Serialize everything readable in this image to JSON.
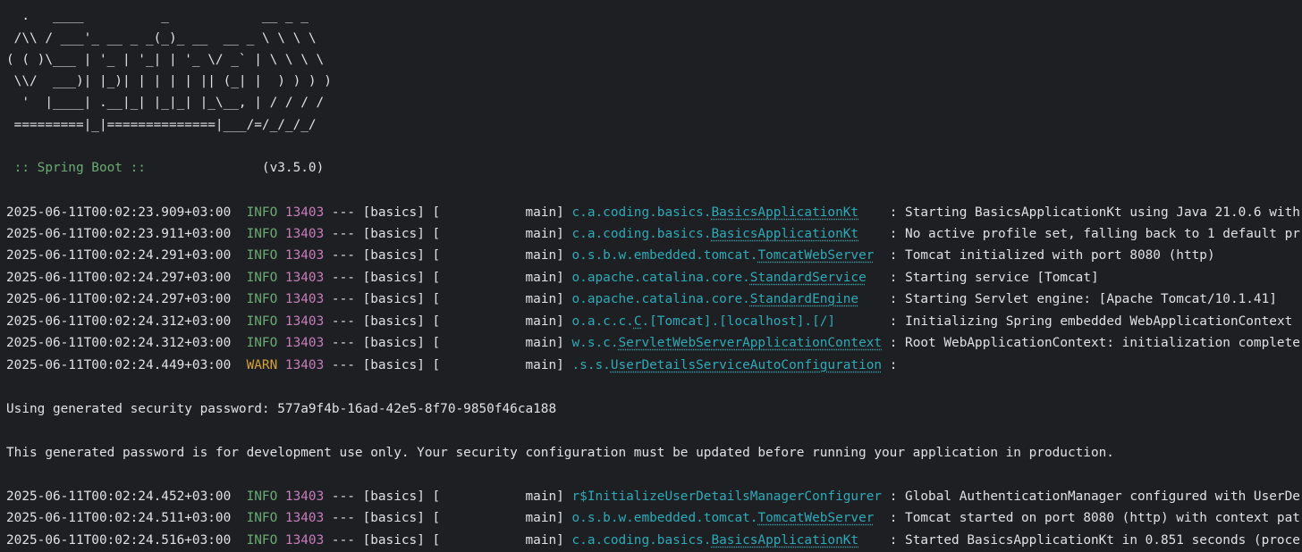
{
  "banner": [
    "  .   ____          _            __ _ _",
    " /\\\\ / ___'_ __ _ _(_)_ __  __ _ \\ \\ \\ \\",
    "( ( )\\___ | '_ | '_| | '_ \\/ _` | \\ \\ \\ \\",
    " \\\\/  ___)| |_)| | | | | || (_| |  ) ) ) )",
    "  '  |____| .__|_| |_|_| |_\\__, | / / / /",
    " =========|_|==============|___/=/_/_/_/"
  ],
  "spring_boot_label": " :: Spring Boot ::",
  "spring_boot_version": "(v3.5.0)",
  "logs_part1": [
    {
      "timestamp": "2025-06-11T00:02:23.909+03:00",
      "level": " INFO",
      "pid": "13403",
      "sep": " --- [basics] [           main] ",
      "logger_prefix": "c.a.coding.basics.",
      "logger_class": "BasicsApplicationKt",
      "logger_pad": "    ",
      "message": ": Starting BasicsApplicationKt using Java 21.0.6 with"
    },
    {
      "timestamp": "2025-06-11T00:02:23.911+03:00",
      "level": " INFO",
      "pid": "13403",
      "sep": " --- [basics] [           main] ",
      "logger_prefix": "c.a.coding.basics.",
      "logger_class": "BasicsApplicationKt",
      "logger_pad": "    ",
      "message": ": No active profile set, falling back to 1 default pr"
    },
    {
      "timestamp": "2025-06-11T00:02:24.291+03:00",
      "level": " INFO",
      "pid": "13403",
      "sep": " --- [basics] [           main] ",
      "logger_prefix": "o.s.b.w.embedded.tomcat.",
      "logger_class": "TomcatWebServer",
      "logger_pad": "  ",
      "message": ": Tomcat initialized with port 8080 (http)"
    },
    {
      "timestamp": "2025-06-11T00:02:24.297+03:00",
      "level": " INFO",
      "pid": "13403",
      "sep": " --- [basics] [           main] ",
      "logger_prefix": "o.apache.catalina.core.",
      "logger_class": "StandardService",
      "logger_pad": "   ",
      "message": ": Starting service [Tomcat]"
    },
    {
      "timestamp": "2025-06-11T00:02:24.297+03:00",
      "level": " INFO",
      "pid": "13403",
      "sep": " --- [basics] [           main] ",
      "logger_prefix": "o.apache.catalina.core.",
      "logger_class": "StandardEngine",
      "logger_pad": "    ",
      "message": ": Starting Servlet engine: [Apache Tomcat/10.1.41]"
    },
    {
      "timestamp": "2025-06-11T00:02:24.312+03:00",
      "level": " INFO",
      "pid": "13403",
      "sep": " --- [basics] [           main] ",
      "logger_prefix": "o.a.c.c.",
      "logger_class": "C",
      "logger_suffix": ".[Tomcat].[localhost].[/]",
      "logger_pad": "       ",
      "message": ": Initializing Spring embedded WebApplicationContext"
    },
    {
      "timestamp": "2025-06-11T00:02:24.312+03:00",
      "level": " INFO",
      "pid": "13403",
      "sep": " --- [basics] [           main] ",
      "logger_prefix": "w.s.c.",
      "logger_class": "ServletWebServerApplicationContext",
      "logger_pad": " ",
      "message": ": Root WebApplicationContext: initialization complete"
    },
    {
      "timestamp": "2025-06-11T00:02:24.449+03:00",
      "level": " WARN",
      "pid": "13403",
      "sep": " --- [basics] [           main] ",
      "logger_prefix": ".s.s.",
      "logger_class": "UserDetailsServiceAutoConfiguration",
      "logger_pad": " ",
      "message": ":"
    }
  ],
  "password_line": "Using generated security password: 577a9f4b-16ad-42e5-8f70-9850f46ca188",
  "dev_notice": "This generated password is for development use only. Your security configuration must be updated before running your application in production.",
  "logs_part2": [
    {
      "timestamp": "2025-06-11T00:02:24.452+03:00",
      "level": " INFO",
      "pid": "13403",
      "sep": " --- [basics] [           main] ",
      "logger_prefix": "r$InitializeUserDetailsManagerConfigurer",
      "logger_class": "",
      "logger_pad": " ",
      "message": ": Global AuthenticationManager configured with UserDe"
    },
    {
      "timestamp": "2025-06-11T00:02:24.511+03:00",
      "level": " INFO",
      "pid": "13403",
      "sep": " --- [basics] [           main] ",
      "logger_prefix": "o.s.b.w.embedded.tomcat.",
      "logger_class": "TomcatWebServer",
      "logger_pad": "  ",
      "message": ": Tomcat started on port 8080 (http) with context pat"
    },
    {
      "timestamp": "2025-06-11T00:02:24.516+03:00",
      "level": " INFO",
      "pid": "13403",
      "sep": " --- [basics] [           main] ",
      "logger_prefix": "c.a.coding.basics.",
      "logger_class": "BasicsApplicationKt",
      "logger_pad": "    ",
      "message": ": Started BasicsApplicationKt in 0.851 seconds (proce"
    }
  ],
  "colors": {
    "background": "#1e1f22",
    "text": "#dfe1e5",
    "info": "#6aab73",
    "warn": "#d6a237",
    "pid": "#c77dbb",
    "logger": "#2aacb8"
  }
}
